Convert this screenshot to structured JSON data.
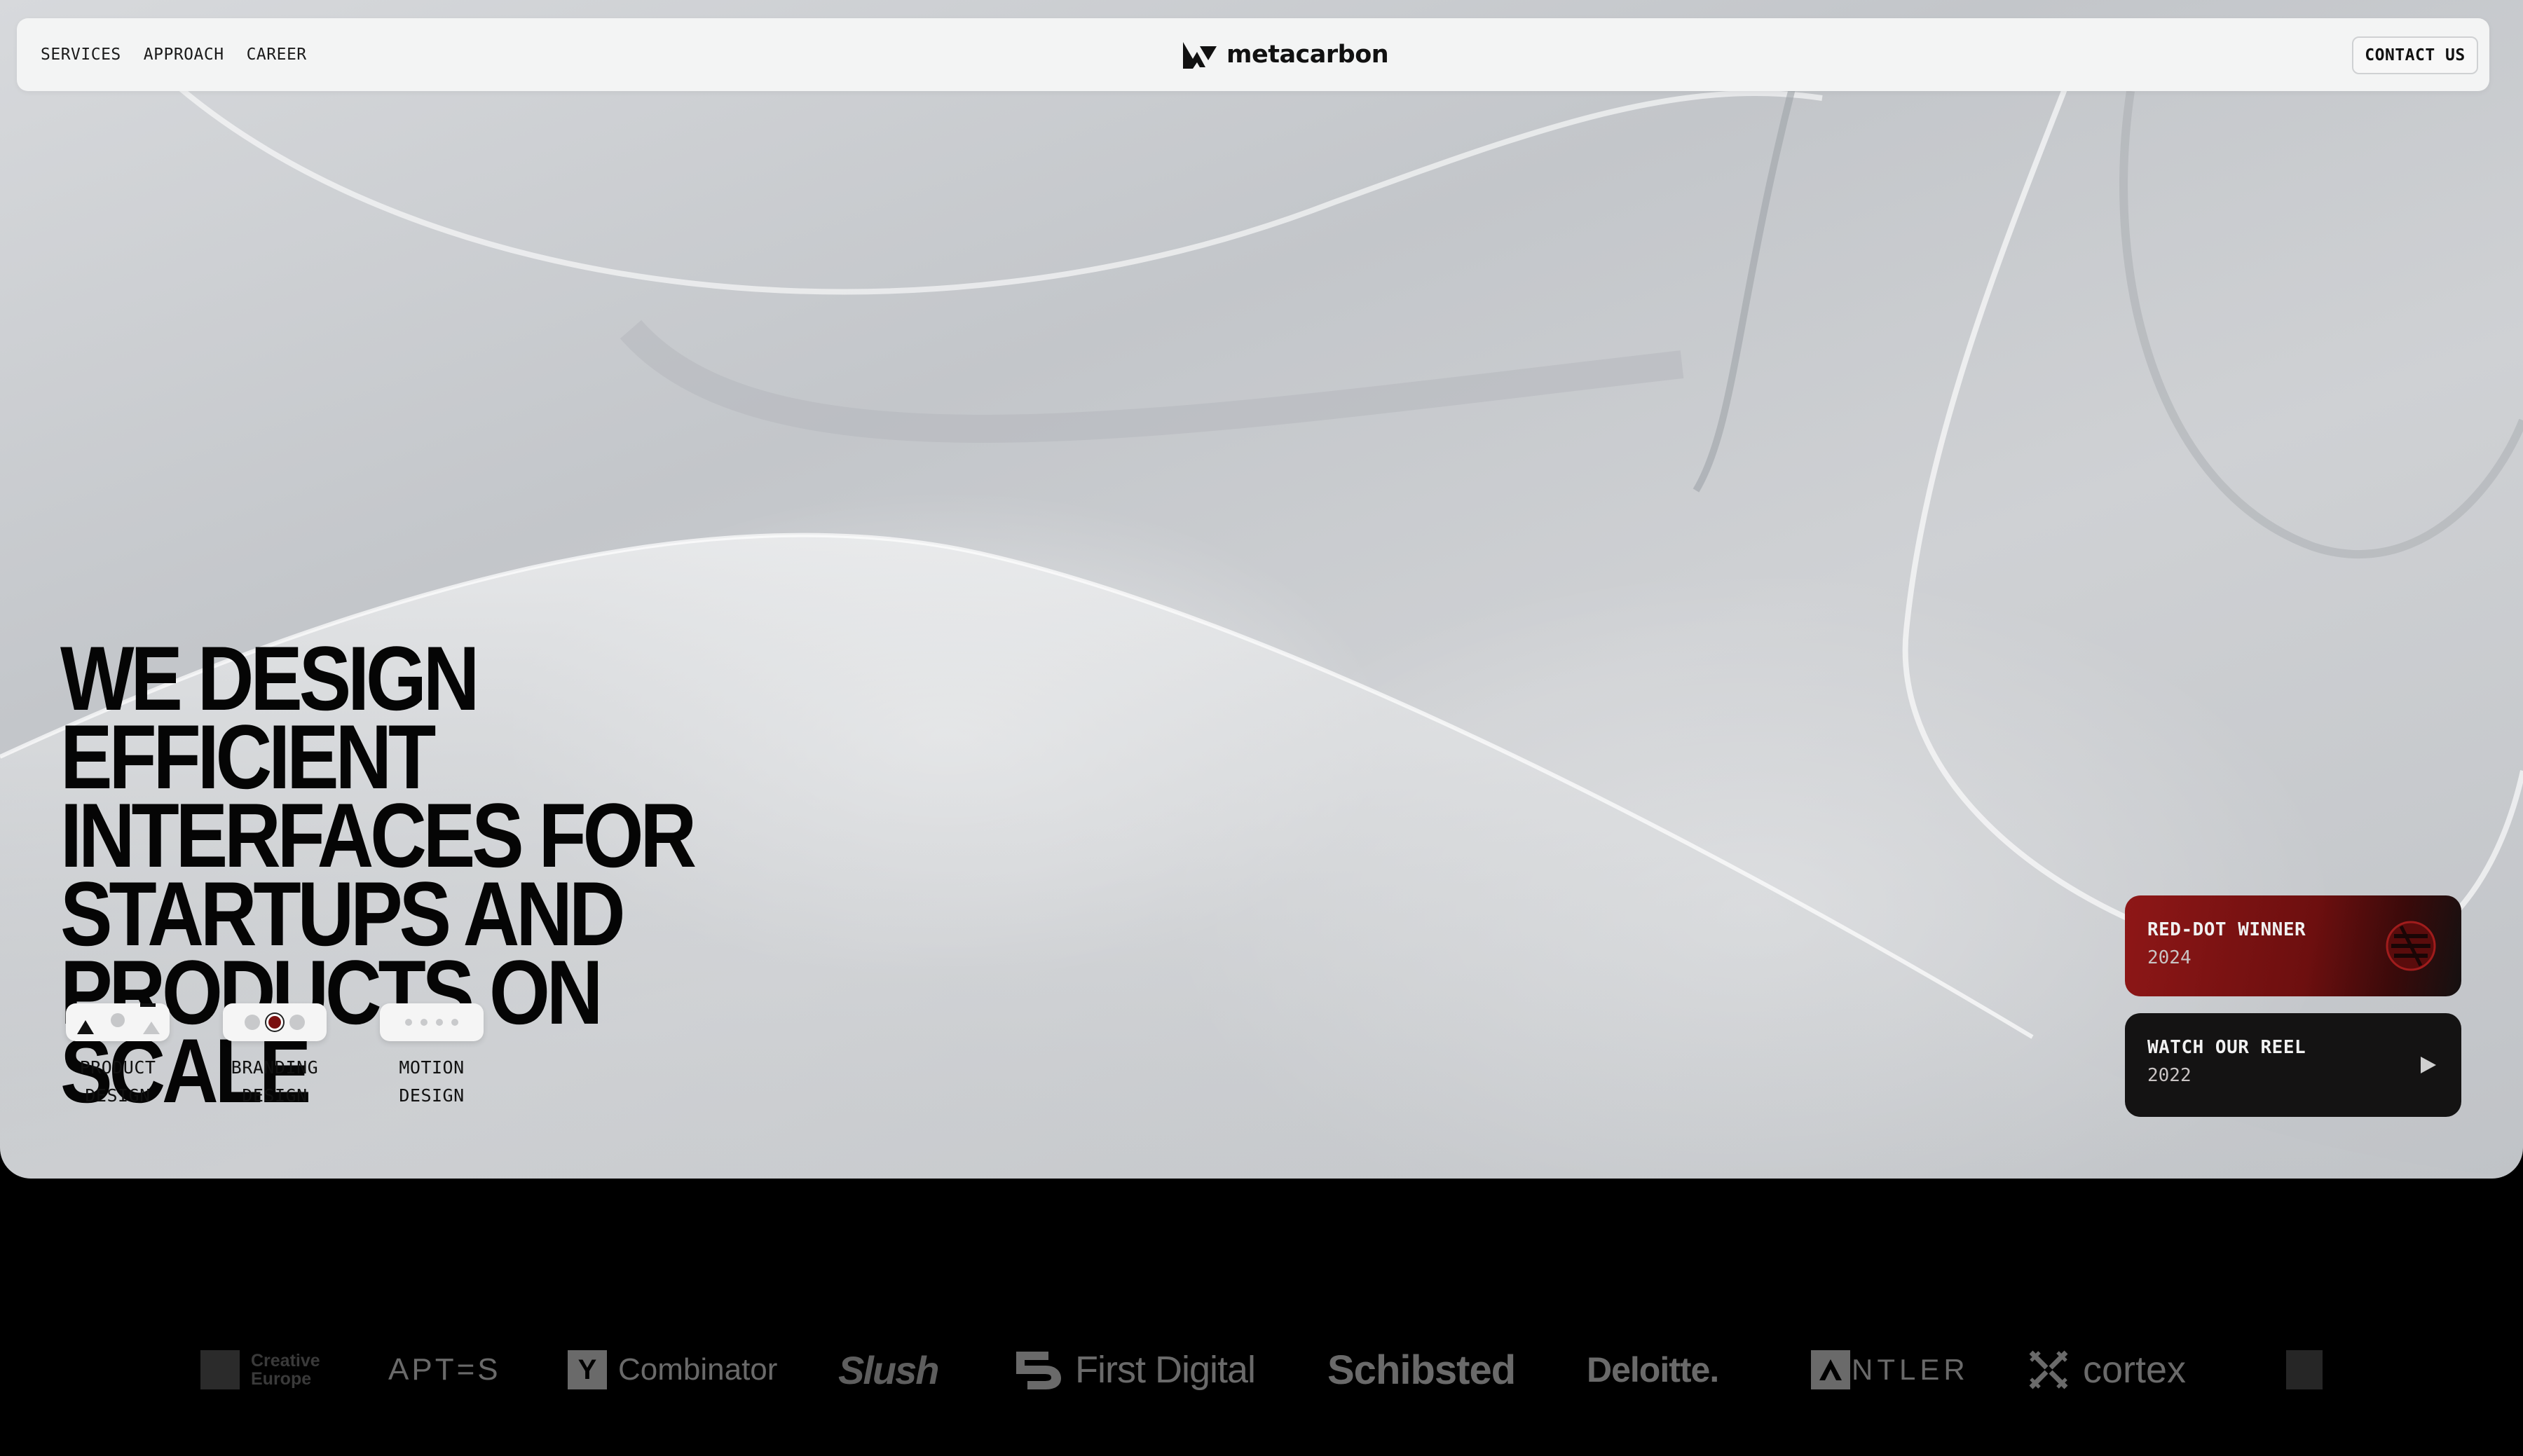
{
  "nav": {
    "links": [
      "SERVICES",
      "APPROACH",
      "CAREER"
    ],
    "brand": "metacarbon",
    "contact_label": "CONTACT US"
  },
  "hero": {
    "headline": "WE DESIGN EFFICIENT\nINTERFACES FOR\nSTARTUPS AND\nPRODUCTS ON SCALE"
  },
  "services": [
    {
      "label": "PRODUCT\nDESIGN",
      "icon": "shapes-icon"
    },
    {
      "label": "BRANDING\nDESIGN",
      "icon": "color-dots-icon"
    },
    {
      "label": "MOTION\nDESIGN",
      "icon": "loading-dots-icon"
    }
  ],
  "cards": {
    "award": {
      "title": "RED-DOT WINNER",
      "year": "2024",
      "icon": "red-dot-logo-icon"
    },
    "reel": {
      "title": "WATCH OUR REEL",
      "year": "2022",
      "icon": "play-icon"
    }
  },
  "clients": {
    "creative_europe_line1": "Creative",
    "creative_europe_line2": "Europe",
    "aptos": "APT=S",
    "yc_badge": "Y",
    "yc_name": "Combinator",
    "slush": "Slush",
    "first_digital": "First Digital",
    "schibsted": "Schibsted",
    "deloitte": "Deloitte.",
    "antler": "NTLER",
    "cortex": "cortex"
  },
  "colors": {
    "hero_bg": "#cbcdd0",
    "page_bg": "#000000",
    "award_red": "#8e1717",
    "logo_gray": "#6a6a6a"
  }
}
